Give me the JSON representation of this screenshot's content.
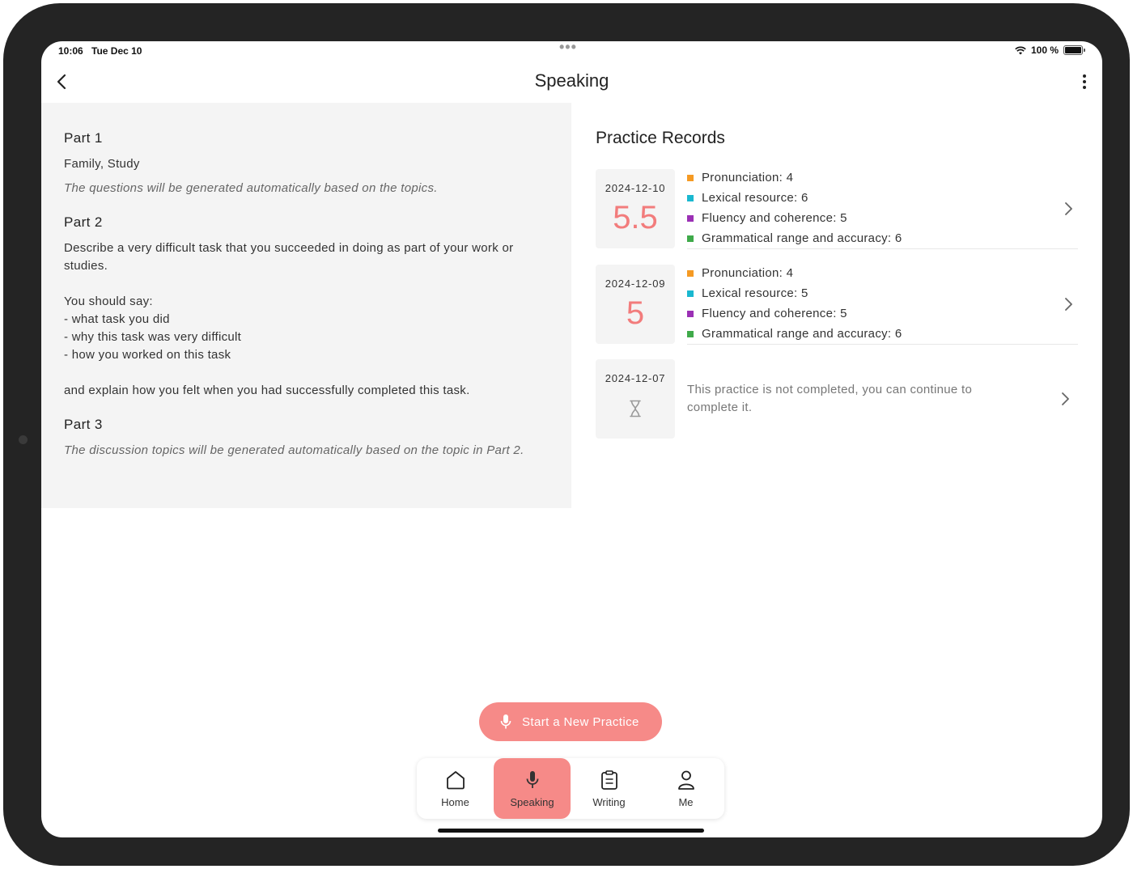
{
  "status_bar": {
    "time": "10:06",
    "date": "Tue Dec 10",
    "battery": "100 %"
  },
  "nav": {
    "title": "Speaking"
  },
  "topic": {
    "part1": {
      "heading": "Part 1",
      "topics": "Family, Study",
      "note": "The questions will be generated automatically based on the topics."
    },
    "part2": {
      "heading": "Part 2",
      "cue_card": "Describe a very difficult task that you succeeded in doing as part of your work or studies.\n\nYou should say:\n- what task you did\n- why this task was very difficult\n- how you worked on this task\n\nand explain how you felt when you had successfully completed this task."
    },
    "part3": {
      "heading": "Part 3",
      "note": "The discussion topics will be generated automatically based on the topic in Part 2."
    }
  },
  "records": {
    "title": "Practice Records",
    "items": [
      {
        "date": "2024-12-10",
        "score": "5.5",
        "criteria": [
          "Pronunciation: 4",
          "Lexical resource: 6",
          "Fluency and coherence: 5",
          "Grammatical range and accuracy: 6"
        ]
      },
      {
        "date": "2024-12-09",
        "score": "5",
        "criteria": [
          "Pronunciation: 4",
          "Lexical resource: 5",
          "Fluency and coherence: 5",
          "Grammatical range and accuracy: 6"
        ]
      },
      {
        "date": "2024-12-07",
        "status_icon": "hourglass-icon",
        "message": "This practice is not completed, you can continue to complete it."
      }
    ],
    "criteria_colors": [
      "#f59a23",
      "#1ab8d0",
      "#9b30b5",
      "#3faa4a"
    ]
  },
  "start_button": {
    "label": "Start a New Practice",
    "icon": "microphone-icon"
  },
  "tabs": [
    {
      "label": "Home",
      "icon": "home-icon"
    },
    {
      "label": "Speaking",
      "icon": "microphone-icon",
      "active": true
    },
    {
      "label": "Writing",
      "icon": "clipboard-icon"
    },
    {
      "label": "Me",
      "icon": "person-icon"
    }
  ],
  "colors": {
    "accent": "#f68a88",
    "score": "#f27c7c",
    "panel_bg": "#f4f4f4"
  }
}
